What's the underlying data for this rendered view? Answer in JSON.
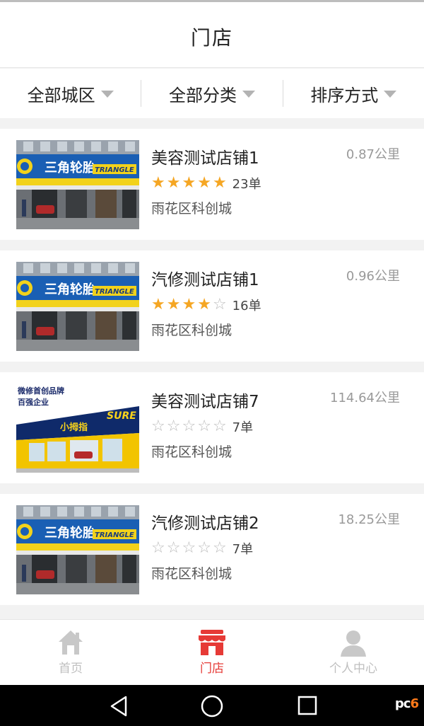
{
  "header": {
    "title": "门店"
  },
  "filters": [
    {
      "label": "全部城区"
    },
    {
      "label": "全部分类"
    },
    {
      "label": "排序方式"
    }
  ],
  "stores": [
    {
      "name": "美容测试店铺1",
      "distance": "0.87公里",
      "rating": 5,
      "orders": "23单",
      "address": "雨花区科创城",
      "image": "triangle-tire-shop-photo"
    },
    {
      "name": "汽修测试店铺1",
      "distance": "0.96公里",
      "rating": 4,
      "orders": "16单",
      "address": "雨花区科创城",
      "image": "triangle-tire-shop-photo"
    },
    {
      "name": "美容测试店铺7",
      "distance": "114.64公里",
      "rating": 0,
      "orders": "7单",
      "address": "雨花区科创城",
      "image": "yellow-storefront-photo"
    },
    {
      "name": "汽修测试店铺2",
      "distance": "18.25公里",
      "rating": 0,
      "orders": "7单",
      "address": "雨花区科创城",
      "image": "triangle-tire-shop-photo"
    }
  ],
  "tabs": [
    {
      "label": "首页",
      "icon": "home-icon",
      "active": false
    },
    {
      "label": "门店",
      "icon": "store-icon",
      "active": true
    },
    {
      "label": "个人中心",
      "icon": "user-icon",
      "active": false
    }
  ],
  "photo_text": {
    "triangle_sign": "三角轮胎",
    "triangle_brand": "TRIANGLE",
    "yellow_top1": "微修首创品牌",
    "yellow_top2": "百强企业",
    "yellow_sign": "小拇指",
    "yellow_brand": "SURE"
  },
  "watermark": {
    "text_a": "pc",
    "text_b": "6"
  },
  "colors": {
    "accent": "#e63a36",
    "star": "#f5a623",
    "inactive": "#bfbfbf"
  }
}
